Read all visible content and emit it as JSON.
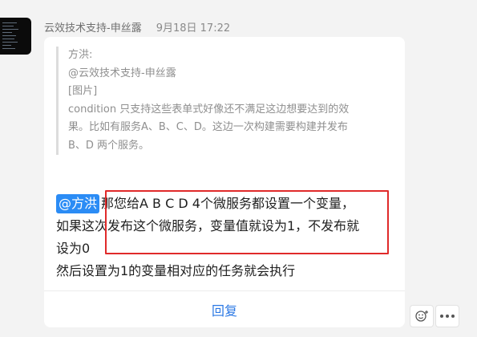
{
  "header": {
    "sender": "云效技术支持-申丝露",
    "time": "9月18日 17:22"
  },
  "quote": {
    "author": "方洪:",
    "mention": "@云效技术支持-申丝露",
    "image_placeholder": "[图片]",
    "lines": [
      "condition 只支持这些表单式好像还不满足这边想要达到的效",
      "果。比如有服务A、B、C、D。这边一次构建需要构建并发布",
      "B、D 两个服务。"
    ]
  },
  "message": {
    "mention": "@方洪",
    "lines": [
      "那您给A B C D 4个微服务都设置一个变量，",
      "如果这次发布这个微服务，变量值就设为1，不发布就",
      "设为0",
      "然后设置为1的变量相对应的任务就会执行"
    ]
  },
  "reply_label": "回复",
  "colors": {
    "mention_bg": "#2b8cf5",
    "link": "#2b78e4",
    "highlight": "#e02a2a"
  },
  "icons": {
    "emoji_reaction": "smiley-plus-icon",
    "more": "more-dots-icon"
  }
}
